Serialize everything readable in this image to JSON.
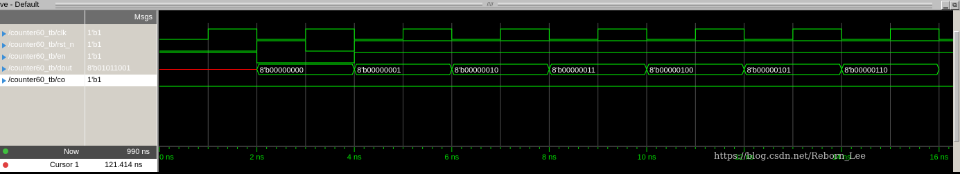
{
  "window": {
    "title": "ve - Default",
    "grip": "////"
  },
  "columns": {
    "msgs": "Msgs"
  },
  "signals": [
    {
      "name": "/counter60_tb/clk",
      "value": "1'b1"
    },
    {
      "name": "/counter60_tb/rst_n",
      "value": "1'b1"
    },
    {
      "name": "/counter60_tb/en",
      "value": "1'b1"
    },
    {
      "name": "/counter60_tb/dout",
      "value": "8'b01011001"
    },
    {
      "name": "/counter60_tb/co",
      "value": "1'b1"
    }
  ],
  "bottom": {
    "now_label": "Now",
    "now_value": "990 ns",
    "cursor_label": "Cursor 1",
    "cursor_value": "121.414 ns"
  },
  "timeline": {
    "ticks": [
      "0 ns",
      "2 ns",
      "4 ns",
      "6 ns",
      "8 ns",
      "10 ns",
      "12 ns",
      "14 ns",
      "16 ns"
    ]
  },
  "dout_values": [
    "8'b00000000",
    "8'b00000001",
    "8'b00000010",
    "8'b00000011",
    "8'b00000100",
    "8'b00000101",
    "8'b00000110"
  ],
  "watermark": "https://blog.csdn.net/Reborn_Lee",
  "colors": {
    "wave": "#00ff00",
    "undefined": "#ff0000",
    "grid": "#4d4d4d",
    "signal_icon": "#3b8fd8"
  }
}
